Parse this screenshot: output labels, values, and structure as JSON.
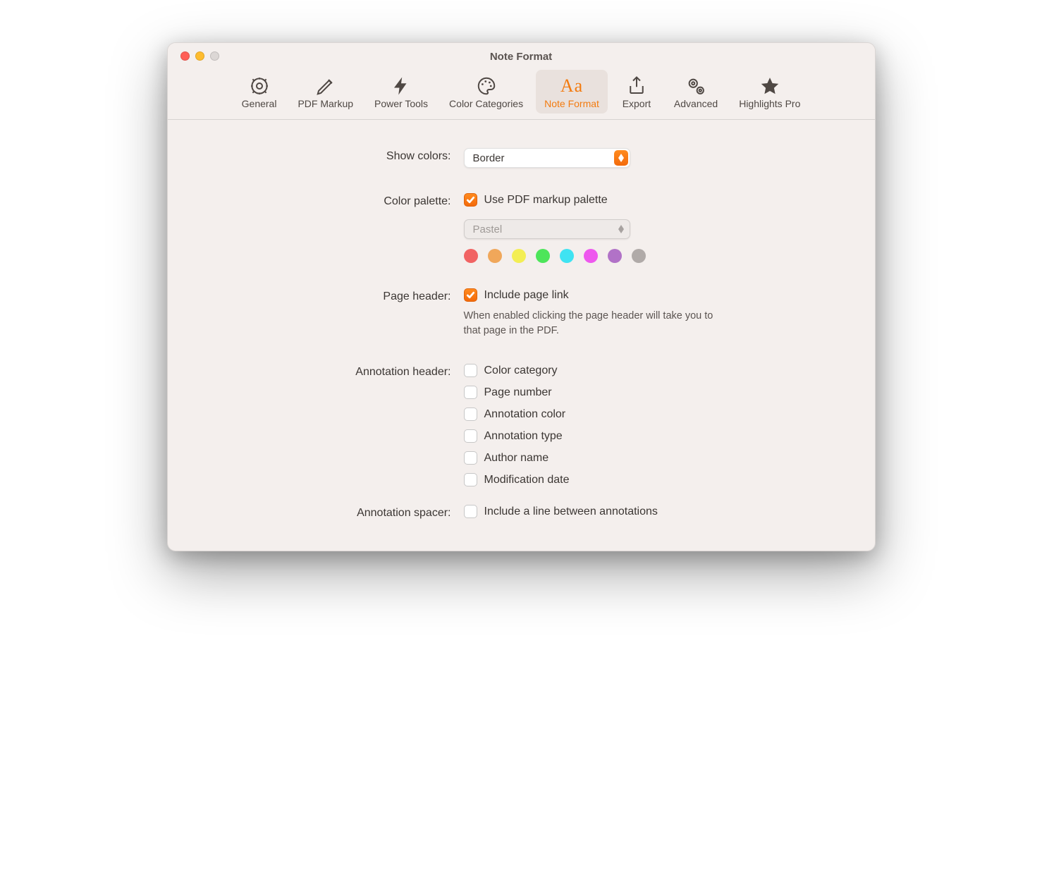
{
  "window": {
    "title": "Note Format"
  },
  "toolbar": {
    "general": "General",
    "pdf_markup": "PDF Markup",
    "power_tools": "Power Tools",
    "color_categories": "Color Categories",
    "note_format": "Note Format",
    "export": "Export",
    "advanced": "Advanced",
    "highlights_pro": "Highlights Pro"
  },
  "form": {
    "show_colors_label": "Show colors:",
    "show_colors_value": "Border",
    "color_palette_label": "Color palette:",
    "use_pdf_markup": "Use PDF markup palette",
    "palette_value": "Pastel",
    "swatches": [
      "#f16363",
      "#f0a75a",
      "#f3ee54",
      "#4de55a",
      "#3fe3f2",
      "#ee58ee",
      "#b172c7",
      "#b0aaa8"
    ],
    "page_header_label": "Page header:",
    "include_page_link": "Include page link",
    "page_header_hint": "When enabled clicking the page header will take you to that page in the PDF.",
    "annotation_header_label": "Annotation header:",
    "ah_color_category": "Color category",
    "ah_page_number": "Page number",
    "ah_annotation_color": "Annotation color",
    "ah_annotation_type": "Annotation type",
    "ah_author_name": "Author name",
    "ah_modification_date": "Modification date",
    "annotation_spacer_label": "Annotation spacer:",
    "include_line": "Include a line between annotations"
  }
}
